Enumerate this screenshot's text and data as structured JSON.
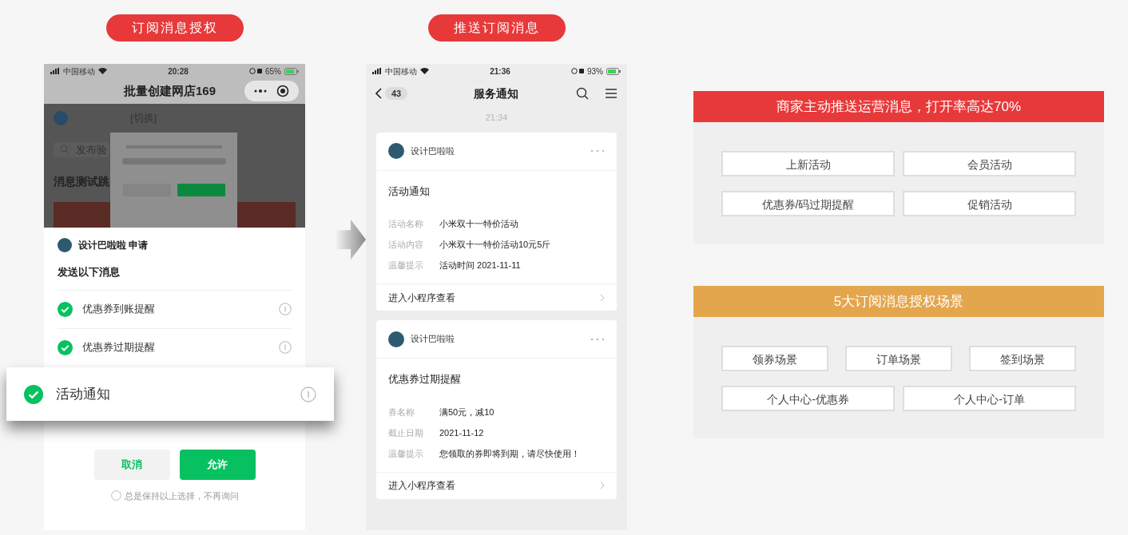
{
  "auth_column": {
    "label": "订阅消息授权",
    "phone": {
      "status": {
        "carrier": "中国移动",
        "time": "20:28",
        "battery": "65%"
      },
      "title": "批量创建网店169",
      "background": {
        "switch": "[切换]",
        "search": "发布验",
        "section": "消息测试跳"
      },
      "sheet": {
        "requester": "设计巴啦啦 申请",
        "heading": "发送以下消息",
        "items": [
          {
            "label": "优惠券到账提醒",
            "checked": true
          },
          {
            "label": "优惠券过期提醒",
            "checked": true
          }
        ],
        "cancel": "取消",
        "allow": "允许",
        "always": {
          "label": "总是保持以上选择，不再询问",
          "checked": false
        }
      }
    },
    "highlight": {
      "label": "活动通知",
      "checked": true
    }
  },
  "notify_column": {
    "label": "推送订阅消息",
    "phone": {
      "status": {
        "carrier": "中国移动",
        "time": "21:36",
        "battery": "93%"
      },
      "back_count": "43",
      "title": "服务通知",
      "timestamp": "21:34",
      "cards": [
        {
          "sender": "设计巴啦啦",
          "title": "活动通知",
          "fields": [
            {
              "label": "活动名称",
              "value": "小米双十一特价活动"
            },
            {
              "label": "活动内容",
              "value": "小米双十一特价活动10元5斤"
            },
            {
              "label": "温馨提示",
              "value": "活动时间 2021-11-11"
            }
          ],
          "link": "进入小程序查看"
        },
        {
          "sender": "设计巴啦啦",
          "title": "优惠券过期提醒",
          "fields": [
            {
              "label": "券名称",
              "value": "满50元，减10"
            },
            {
              "label": "截止日期",
              "value": "2021-11-12"
            },
            {
              "label": "温馨提示",
              "value": "您领取的券即将到期，请尽快使用！"
            }
          ],
          "link": "进入小程序查看"
        }
      ]
    }
  },
  "panels": [
    {
      "title": "商家主动推送运营消息，打开率高达70%",
      "color": "#e8393a",
      "rows": [
        [
          "上新活动",
          "会员活动"
        ],
        [
          "优惠券/码过期提醒",
          "促销活动"
        ]
      ]
    },
    {
      "title": "5大订阅消息授权场景",
      "color": "#e4a64d",
      "rows": [
        [
          "领券场景",
          "订单场景",
          "签到场景"
        ],
        [
          "个人中心-优惠券",
          "个人中心-订单"
        ]
      ]
    }
  ]
}
